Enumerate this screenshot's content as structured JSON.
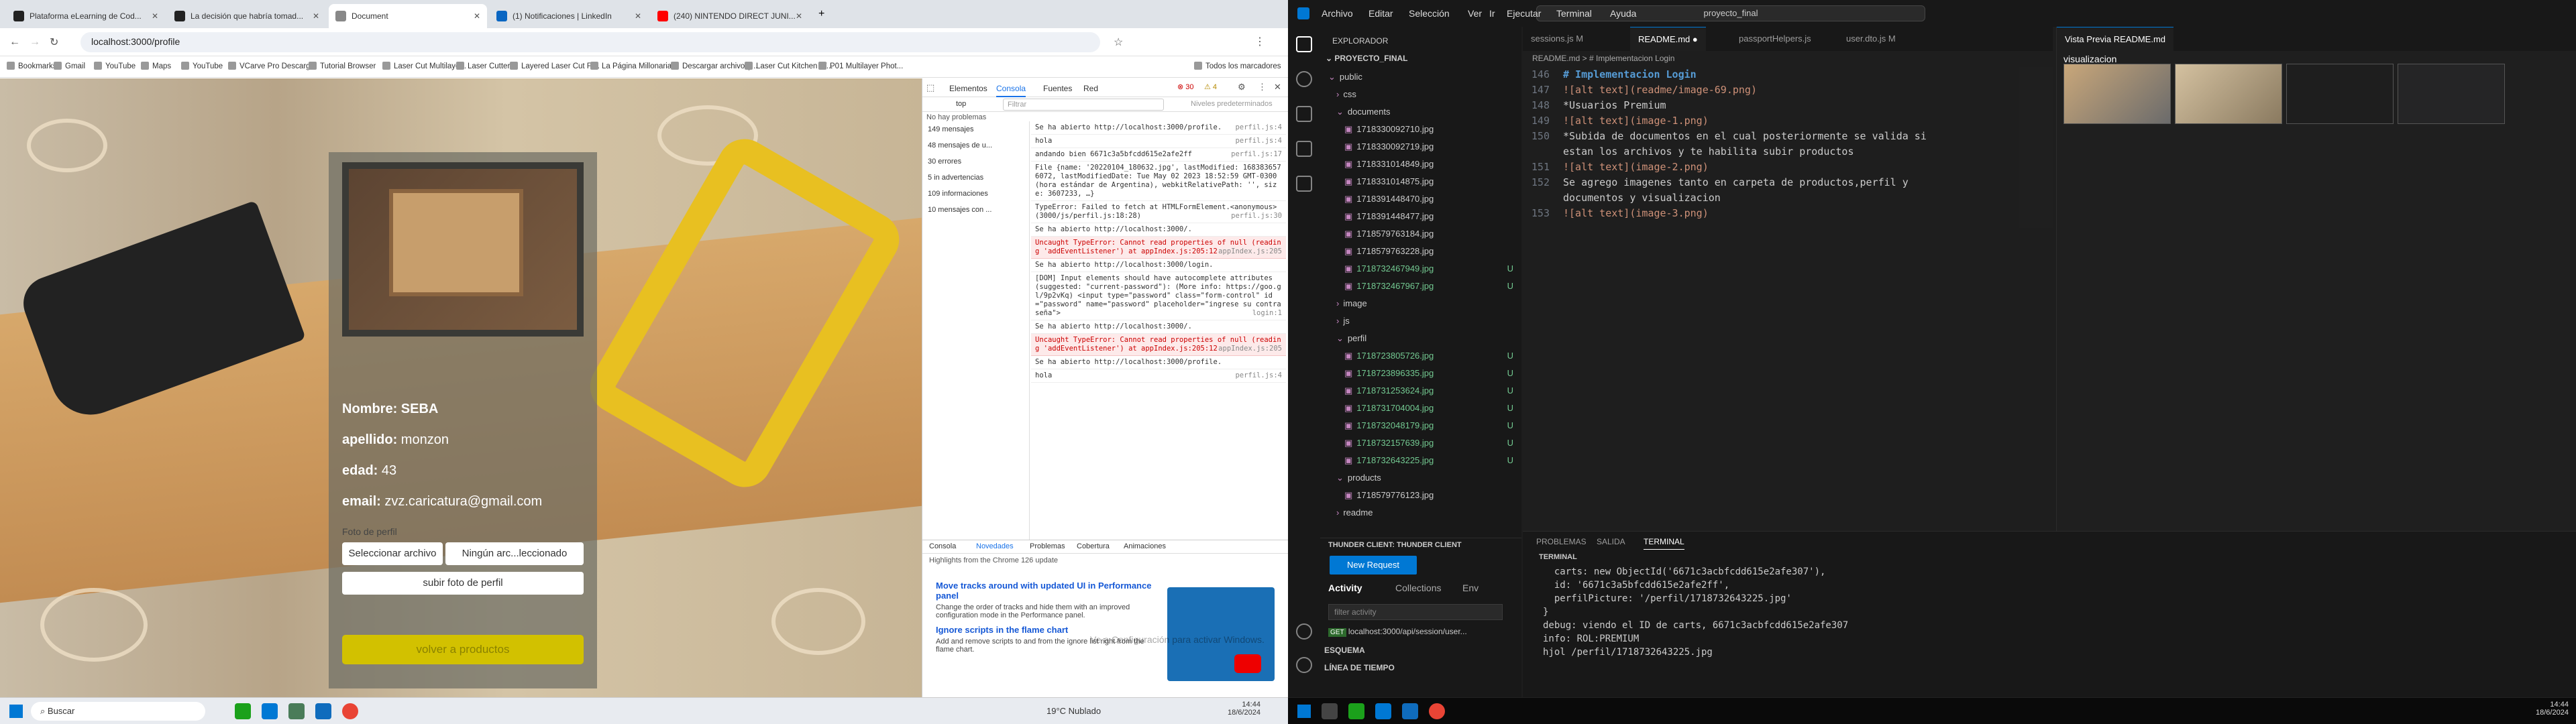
{
  "chrome": {
    "tabs": [
      {
        "label": "Plataforma eLearning de Cod...",
        "color": "#222"
      },
      {
        "label": "La decisión que habría tomad...",
        "color": "#222"
      },
      {
        "label": "Document",
        "color": "#888"
      },
      {
        "label": "(1) Notificaciones | LinkedIn",
        "color": "#0a66c2"
      },
      {
        "label": "(240) NINTENDO DIRECT JUNI...",
        "color": "#ff0000"
      }
    ],
    "url": "localhost:3000/profile",
    "bookmarks": [
      "Bookmarks",
      "Gmail",
      "YouTube",
      "Maps",
      "YouTube",
      "VCarve Pro Descarg...",
      "Tutorial Browser",
      "Laser Cut Multilaye...",
      "Laser Cutter",
      "Layered Laser Cut Fi...",
      "La Página Millonaria...",
      "Descargar archivo g...",
      "Laser Cut Kitchen W...",
      "P01 Multilayer Phot..."
    ],
    "bookmarks_all": "Todos los marcadores"
  },
  "profile": {
    "nombre_label": "Nombre:",
    "nombre": "SEBA",
    "apellido_label": "apellido:",
    "apellido": "monzon",
    "edad_label": "edad:",
    "edad": "43",
    "email_label": "email:",
    "email": "zvz.caricatura@gmail.com",
    "foto_label": "Foto de perfil",
    "select_file": "Seleccionar archivo",
    "no_file": "Ningún arc...leccionado",
    "upload_button": "subir foto de perfil",
    "back_button": "volver a productos"
  },
  "devtools": {
    "tabs": [
      "Elementos",
      "Consola",
      "Fuentes",
      "Red"
    ],
    "error_count": "30",
    "warn_count": "4",
    "top_context": "top",
    "filter_placeholder": "Filtrar",
    "levels": "Niveles predeterminados",
    "issues": "No hay problemas",
    "sidebar": [
      "149 mensajes",
      "48 mensajes de u...",
      "30 errores",
      "5 in advertencias",
      "109 informaciones",
      "10 mensajes con ..."
    ],
    "logs": [
      {
        "type": "info",
        "text": "Se ha abierto http://localhost:3000/profile.",
        "src": "perfil.js:4"
      },
      {
        "type": "info",
        "text": "hola",
        "src": "perfil.js:4"
      },
      {
        "type": "info",
        "text": "andando bien 6671c3a5bfcdd615e2afe2ff",
        "src": "perfil.js:17"
      },
      {
        "type": "info",
        "text": "File {name: '20220104_180632.jpg', lastModified: 1683836576072, lastModifiedDate: Tue May 02 2023 18:52:59 GMT-0300 (hora estándar de Argentina), webkitRelativePath: '', size: 3607233, …}",
        "src": ""
      },
      {
        "type": "info",
        "text": "TypeError: Failed to fetch at HTMLFormElement.<anonymous> (3000/js/perfil.js:18:28)",
        "src": "perfil.js:30"
      },
      {
        "type": "info",
        "text": "Se ha abierto http://localhost:3000/.",
        "src": ""
      },
      {
        "type": "err",
        "text": "Uncaught TypeError: Cannot read properties of null (reading 'addEventListener') at appIndex.js:205:12",
        "src": "appIndex.js:205"
      },
      {
        "type": "info",
        "text": "Se ha abierto http://localhost:3000/login.",
        "src": ""
      },
      {
        "type": "info",
        "text": "[DOM] Input elements should have autocomplete attributes (suggested: \"current-password\"): (More info: https://goo.gl/9p2vKq) <input type=\"password\" class=\"form-control\" id=\"password\" name=\"password\" placeholder=\"ingrese su contraseña\">",
        "src": "login:1"
      },
      {
        "type": "info",
        "text": "Se ha abierto http://localhost:3000/.",
        "src": ""
      },
      {
        "type": "err",
        "text": "Uncaught TypeError: Cannot read properties of null (reading 'addEventListener') at appIndex.js:205:12",
        "src": "appIndex.js:205"
      },
      {
        "type": "info",
        "text": "Se ha abierto http://localhost:3000/profile.",
        "src": ""
      },
      {
        "type": "info",
        "text": "hola",
        "src": "perfil.js:4"
      }
    ],
    "drawer_tabs": [
      "Consola",
      "Novedades",
      "Problemas",
      "Cobertura",
      "Animaciones"
    ],
    "highlights": "Highlights from the Chrome 126 update",
    "news": [
      {
        "title": "Move tracks around with updated UI in Performance panel",
        "desc": "Change the order of tracks and hide them with an improved configuration mode in the Performance panel."
      },
      {
        "title": "Ignore scripts in the flame chart",
        "desc": "Add and remove scripts to and from the ignore list right from the flame chart."
      }
    ],
    "watermark": "Ve a Configuración para activar Windows."
  },
  "taskbar_left": {
    "search": "Buscar",
    "weather": "19°C  Nublado",
    "time": "14:44",
    "date": "18/6/2024"
  },
  "vscode": {
    "menus": [
      "Archivo",
      "Editar",
      "Selección",
      "Ver",
      "Ir",
      "Ejecutar",
      "Terminal",
      "Ayuda"
    ],
    "search": "proyecto_final",
    "explorer_title": "EXPLORADOR",
    "project": "PROYECTO_FINAL",
    "tree": [
      {
        "name": "public",
        "indent": 1,
        "kind": "folder-open",
        "u": ""
      },
      {
        "name": "css",
        "indent": 2,
        "kind": "folder",
        "u": ""
      },
      {
        "name": "documents",
        "indent": 2,
        "kind": "folder-open",
        "u": ""
      },
      {
        "name": "1718330092710.jpg",
        "indent": 3,
        "kind": "file",
        "u": ""
      },
      {
        "name": "1718330092719.jpg",
        "indent": 3,
        "kind": "file",
        "u": ""
      },
      {
        "name": "1718331014849.jpg",
        "indent": 3,
        "kind": "file",
        "u": ""
      },
      {
        "name": "1718331014875.jpg",
        "indent": 3,
        "kind": "file",
        "u": ""
      },
      {
        "name": "1718391448470.jpg",
        "indent": 3,
        "kind": "file",
        "u": ""
      },
      {
        "name": "1718391448477.jpg",
        "indent": 3,
        "kind": "file",
        "u": ""
      },
      {
        "name": "1718579763184.jpg",
        "indent": 3,
        "kind": "file",
        "u": ""
      },
      {
        "name": "1718579763228.jpg",
        "indent": 3,
        "kind": "file",
        "u": ""
      },
      {
        "name": "1718732467949.jpg",
        "indent": 3,
        "kind": "file",
        "u": "U"
      },
      {
        "name": "1718732467967.jpg",
        "indent": 3,
        "kind": "file",
        "u": "U"
      },
      {
        "name": "image",
        "indent": 2,
        "kind": "folder",
        "u": ""
      },
      {
        "name": "js",
        "indent": 2,
        "kind": "folder",
        "u": ""
      },
      {
        "name": "perfil",
        "indent": 2,
        "kind": "folder-open",
        "u": ""
      },
      {
        "name": "1718723805726.jpg",
        "indent": 3,
        "kind": "file",
        "u": "U"
      },
      {
        "name": "1718723896335.jpg",
        "indent": 3,
        "kind": "file",
        "u": "U"
      },
      {
        "name": "1718731253624.jpg",
        "indent": 3,
        "kind": "file",
        "u": "U"
      },
      {
        "name": "1718731704004.jpg",
        "indent": 3,
        "kind": "file",
        "u": "U"
      },
      {
        "name": "1718732048179.jpg",
        "indent": 3,
        "kind": "file",
        "u": "U"
      },
      {
        "name": "1718732157639.jpg",
        "indent": 3,
        "kind": "file",
        "u": "U"
      },
      {
        "name": "1718732643225.jpg",
        "indent": 3,
        "kind": "file",
        "u": "U"
      },
      {
        "name": "products",
        "indent": 2,
        "kind": "folder-open",
        "u": ""
      },
      {
        "name": "1718579776123.jpg",
        "indent": 3,
        "kind": "file",
        "u": ""
      },
      {
        "name": "readme",
        "indent": 2,
        "kind": "folder",
        "u": ""
      }
    ],
    "editor_tabs": [
      "sessions.js M",
      "README.md ●",
      "passportHelpers.js",
      "user.dto.js M"
    ],
    "breadcrumb": "README.md > # Implementacion Login",
    "code": [
      {
        "n": "146",
        "t": "# Implementacion Login",
        "c": "md-h"
      },
      {
        "n": "147",
        "t": "![alt text](readme/image-69.png)",
        "c": "md-link"
      },
      {
        "n": "148",
        "t": "*Usuarios Premium",
        "c": ""
      },
      {
        "n": "149",
        "t": "![alt text](image-1.png)",
        "c": "md-link"
      },
      {
        "n": "150",
        "t": "*Subida de documentos en el cual posteriormente se valida si",
        "c": ""
      },
      {
        "n": "",
        "t": "estan los archivos y te habilita subir productos",
        "c": ""
      },
      {
        "n": "151",
        "t": "![alt text](image-2.png)",
        "c": "md-link"
      },
      {
        "n": "152",
        "t": "Se agrego imagenes tanto en carpeta de productos,perfil y",
        "c": ""
      },
      {
        "n": "",
        "t": "documentos y visualizacion",
        "c": ""
      },
      {
        "n": "153",
        "t": "![alt text](image-3.png)",
        "c": "md-link"
      }
    ],
    "preview_tab": "Vista Previa README.md",
    "preview_heading": "visualizacion",
    "panel_tabs": [
      "PROBLEMAS",
      "SALIDA",
      "TERMINAL"
    ],
    "terminal_title": "TERMINAL",
    "terminal_lines": [
      "  carts: new ObjectId('6671c3acbfcdd615e2afe307'),",
      "  id: '6671c3a5bfcdd615e2afe2ff',",
      "  perfilPicture: '/perfil/1718732643225.jpg'",
      "}",
      "debug: viendo el ID de carts, 6671c3acbfcdd615e2afe307",
      "info: ROL:PREMIUM",
      "hjol /perfil/1718732643225.jpg"
    ],
    "thunder_title": "THUNDER CLIENT: THUNDER CLIENT",
    "new_request": "New Request",
    "thunder_tabs": [
      "Activity",
      "Collections",
      "Env"
    ],
    "filter_placeholder": "filter activity",
    "activity_item_method": "GET",
    "activity_item": "localhost:3000/api/session/user...",
    "esquema": "ESQUEMA",
    "linea": "LÍNEA DE TIEMPO"
  },
  "taskbar_right": {
    "time": "14:44",
    "date": "18/6/2024"
  }
}
